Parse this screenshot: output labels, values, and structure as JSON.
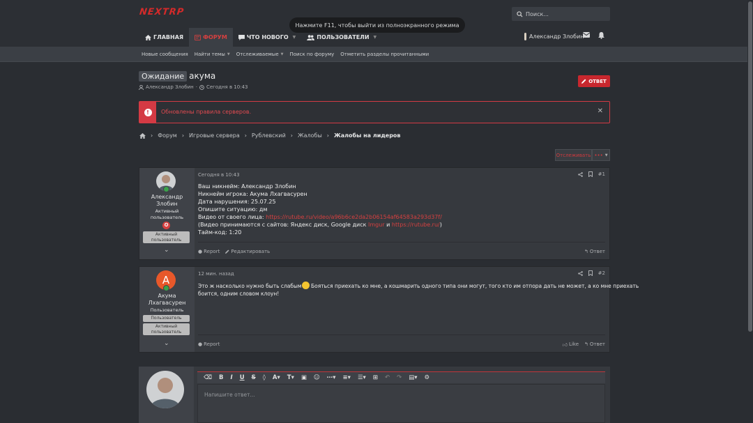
{
  "header": {
    "logo_text": "NEXTRP",
    "search_placeholder": "Поиск...",
    "fullscreen_toast": "Нажмите F11, чтобы выйти из полноэкранного режима",
    "nav": [
      {
        "label": "ГЛАВНАЯ",
        "icon": "home-icon"
      },
      {
        "label": "ФОРУМ",
        "icon": "forum-icon"
      },
      {
        "label": "ЧТО НОВОГО",
        "icon": "chat-icon"
      },
      {
        "label": "ПОЛЬЗОВАТЕЛИ",
        "icon": "users-icon"
      }
    ],
    "user_name": "Александр Злобин"
  },
  "subnav": [
    "Новые сообщения",
    "Найти темы",
    "Отслеживаемые",
    "Поиск по форуму",
    "Отметить разделы прочитанными"
  ],
  "thread": {
    "prefix": "Ожидание",
    "title": "акума",
    "author": "Александр Злобин",
    "date": "Сегодня в 10:43",
    "reply_button": "ОТВЕТ"
  },
  "notice": {
    "text": "Обновлены правила серверов.",
    "icon": "!"
  },
  "breadcrumbs": [
    "Форум",
    "Игровые сервера",
    "Рублевский",
    "Жалобы",
    "Жалобы на лидеров"
  ],
  "actions": {
    "follow": "Отслеживать",
    "more": "•••"
  },
  "posts": [
    {
      "author_line1": "Александр",
      "author_line2": "Злобин",
      "role_line1": "Активный",
      "role_line2": "пользователь",
      "badges": [
        "Активный пользователь"
      ],
      "date": "Сегодня в 10:43",
      "number": "#1",
      "lines": [
        "Ваш никнейм: Александр Злобин",
        "Никнейм игрока: Акума Лхагвасурен",
        "Дата нарушения: 25.07.25",
        "Опишите ситуацию: дм",
        "Видео от своего лица: ",
        "(Видео принимаются с сайтов: Яндекс диск, Google диск ",
        "Тайм-код: 1:20"
      ],
      "video_link": "https://rutube.ru/video/a96b6ce2da2b06154af64583a293d37f/",
      "link_imgur": "Imgur",
      "link_and": " и ",
      "link_rutube": "https://rutube.ru/",
      "link_close": ")",
      "foot_report": "Report",
      "foot_edit": "Редактировать",
      "foot_reply": "Ответ"
    },
    {
      "avatar_letter": "А",
      "avatar_color": "#e8582a",
      "author_line1": "Акума",
      "author_line2": "Лхагвасурен",
      "role_line1": "Пользователь",
      "badges": [
        "Пользователь",
        "Активный пользователь"
      ],
      "date": "12 мин. назад",
      "number": "#2",
      "text_line1": "Это ж насколько нужно быть слабым",
      "text_line1b": " Бояться приехать ко мне, а кошмарить одного типа они могут, того кто им отпора дать не может, а ко мне приехать",
      "text_line2": "боится, одним словом клоун!",
      "foot_report": "Report",
      "foot_like": "Like",
      "foot_reply": "Ответ"
    }
  ],
  "editor": {
    "placeholder": "Напишите ответ..."
  },
  "colors": {
    "accent": "#d64040",
    "background": "#2a2d32",
    "panel": "#36393e"
  }
}
